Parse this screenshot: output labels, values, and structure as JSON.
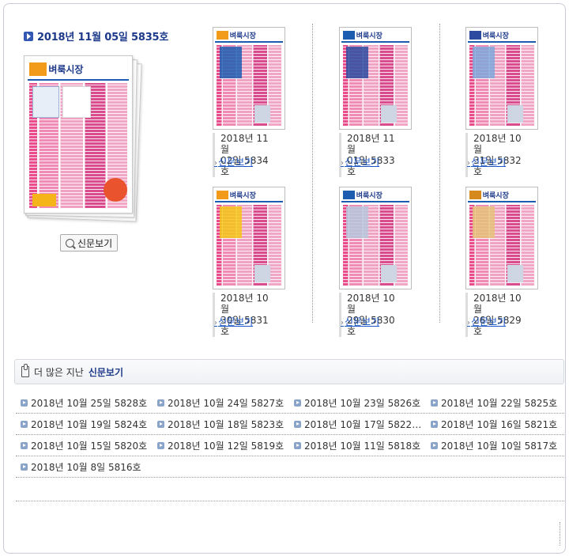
{
  "featured": {
    "title": "2018년 11월 05일 5835호",
    "masthead": "벼룩시장",
    "view_button": "신문보기"
  },
  "editions": [
    {
      "line1": "2018년 11월",
      "line2": "02일 5834호",
      "link": "신문보기"
    },
    {
      "line1": "2018년 11월",
      "line2": "01일 5833호",
      "link": "신문보기"
    },
    {
      "line1": "2018년 10월",
      "line2": "31일 5832호",
      "link": "신문보기"
    },
    {
      "line1": "2018년 10월",
      "line2": "30일 5831호",
      "link": "신문보기"
    },
    {
      "line1": "2018년 10월",
      "line2": "29일 5830호",
      "link": "신문보기"
    },
    {
      "line1": "2018년 10월",
      "line2": "26일 5829호",
      "link": "신문보기"
    }
  ],
  "thumb_masthead": "벼룩시장",
  "more": {
    "prefix": "더 많은 지난",
    "highlight": "신문보기"
  },
  "archive": [
    "2018년 10월 25일 5828호",
    "2018년 10월 24일 5827호",
    "2018년 10월 23일 5826호",
    "2018년 10월 22일 5825호",
    "2018년 10월 19일 5824호",
    "2018년 10월 18일 5823호",
    "2018년 10월 17일 5822호 ...",
    "2018년 10월 16일 5821호",
    "2018년 10월 15일 5820호",
    "2018년 10월 12일 5819호",
    "2018년 10월 11일 5818호",
    "2018년 10월 10일 5817호",
    "2018년 10월 8일 5816호"
  ]
}
